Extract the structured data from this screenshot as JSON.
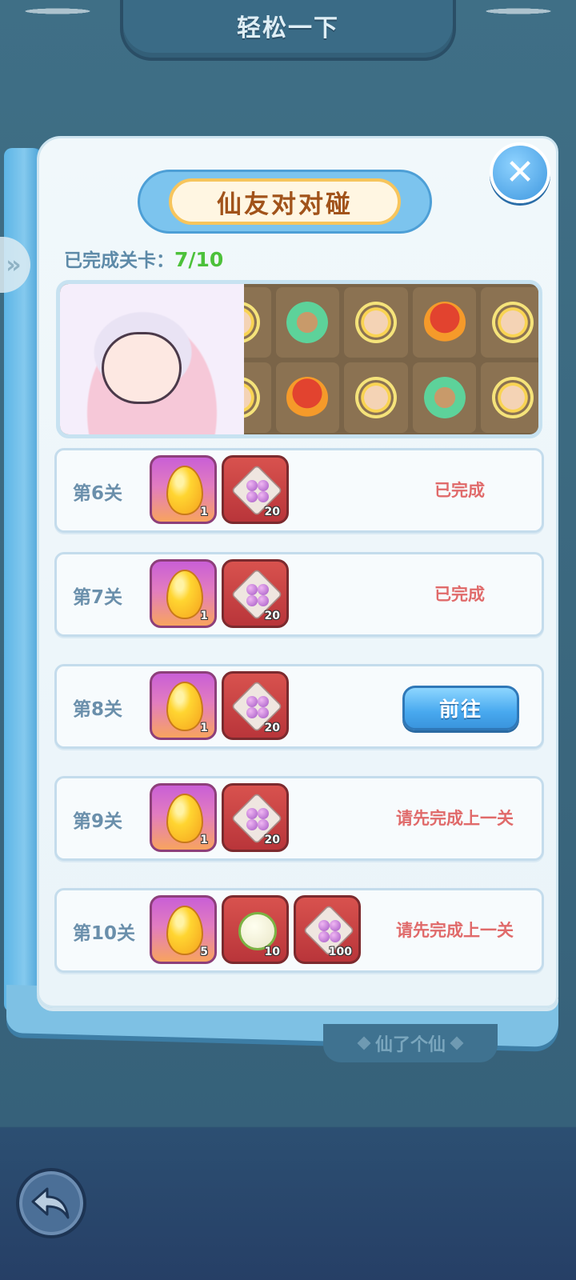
{
  "header": {
    "title": "轻松一下"
  },
  "panel": {
    "title": "仙友对对碰",
    "progress_label": "已完成关卡：",
    "progress_value": "7/10",
    "bottom_tab": "仙了个仙"
  },
  "levels": [
    {
      "name": "第6关",
      "rewards": [
        {
          "type": "egg",
          "count": "1"
        },
        {
          "type": "beads",
          "count": "20"
        }
      ],
      "status": "已完成"
    },
    {
      "name": "第7关",
      "rewards": [
        {
          "type": "egg",
          "count": "1"
        },
        {
          "type": "beads",
          "count": "20"
        }
      ],
      "status": "已完成"
    },
    {
      "name": "第8关",
      "rewards": [
        {
          "type": "egg",
          "count": "1"
        },
        {
          "type": "beads",
          "count": "20"
        }
      ],
      "action": "前往"
    },
    {
      "name": "第9关",
      "rewards": [
        {
          "type": "egg",
          "count": "1"
        },
        {
          "type": "beads",
          "count": "20"
        }
      ],
      "status": "请先完成上一关"
    },
    {
      "name": "第10关",
      "rewards": [
        {
          "type": "egg",
          "count": "5"
        },
        {
          "type": "rice",
          "count": "10"
        },
        {
          "type": "beads",
          "count": "100"
        }
      ],
      "status": "请先完成上一关"
    }
  ],
  "icons": {
    "close": "close-icon",
    "side": "chevron-double-right-icon",
    "back": "back-arrow-icon"
  },
  "colors": {
    "completed": "#e06a6a",
    "progress": "#4cc13a",
    "button": "#48a9ef"
  }
}
